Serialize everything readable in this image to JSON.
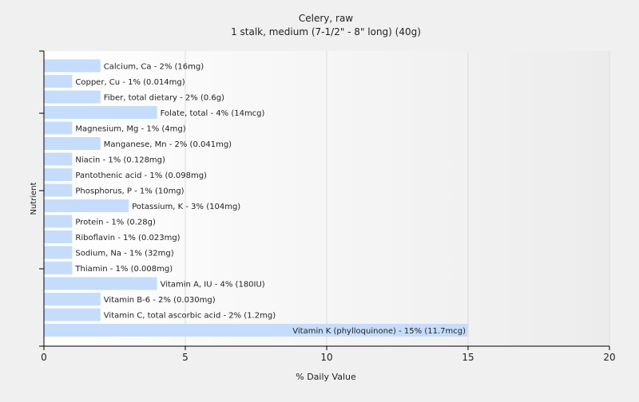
{
  "chart_data": {
    "type": "bar",
    "orientation": "horizontal",
    "title": "Celery, raw",
    "subtitle": "1 stalk, medium (7-1/2\" - 8\" long) (40g)",
    "xlabel": "% Daily Value",
    "ylabel": "Nutrient",
    "xlim": [
      0,
      20
    ],
    "xticks": [
      "0",
      "5",
      "10",
      "15",
      "20"
    ],
    "grid": true,
    "bar_color": "#c6dcfb",
    "categories": [
      "Calcium, Ca",
      "Copper, Cu",
      "Fiber, total dietary",
      "Folate, total",
      "Magnesium, Mg",
      "Manganese, Mn",
      "Niacin",
      "Pantothenic acid",
      "Phosphorus, P",
      "Potassium, K",
      "Protein",
      "Riboflavin",
      "Sodium, Na",
      "Thiamin",
      "Vitamin A, IU",
      "Vitamin B-6",
      "Vitamin C, total ascorbic acid",
      "Vitamin K (phylloquinone)"
    ],
    "values": [
      2,
      1,
      2,
      4,
      1,
      2,
      1,
      1,
      1,
      3,
      1,
      1,
      1,
      1,
      4,
      2,
      2,
      15
    ],
    "labels": [
      "Calcium, Ca - 2% (16mg)",
      "Copper, Cu - 1% (0.014mg)",
      "Fiber, total dietary - 2% (0.6g)",
      "Folate, total - 4% (14mcg)",
      "Magnesium, Mg - 1% (4mg)",
      "Manganese, Mn - 2% (0.041mg)",
      "Niacin - 1% (0.128mg)",
      "Pantothenic acid - 1% (0.098mg)",
      "Phosphorus, P - 1% (10mg)",
      "Potassium, K - 3% (104mg)",
      "Protein - 1% (0.28g)",
      "Riboflavin - 1% (0.023mg)",
      "Sodium, Na - 1% (32mg)",
      "Thiamin - 1% (0.008mg)",
      "Vitamin A, IU - 4% (180IU)",
      "Vitamin B-6 - 2% (0.030mg)",
      "Vitamin C, total ascorbic acid - 2% (1.2mg)",
      "Vitamin K (phylloquinone) - 15% (11.7mcg)"
    ]
  }
}
